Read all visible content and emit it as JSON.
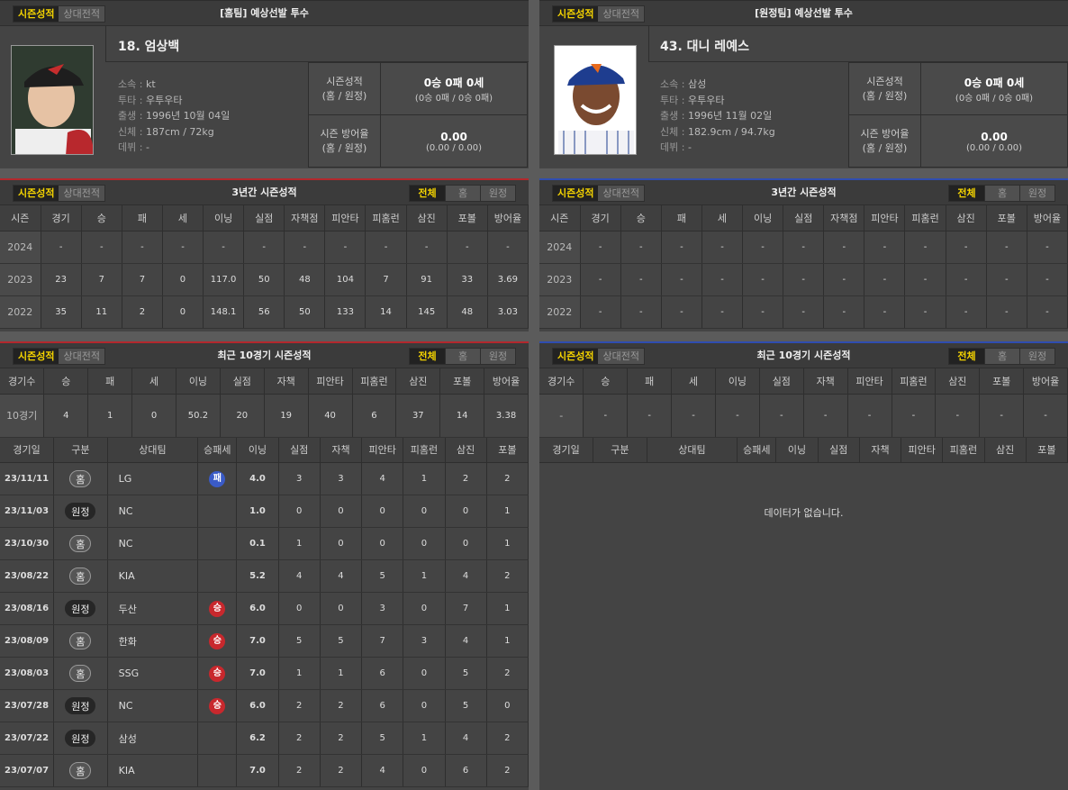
{
  "tabs": {
    "season": "시즌성적",
    "vs": "상대전적"
  },
  "seg": {
    "all": "전체",
    "home": "홈",
    "away": "원정"
  },
  "home": {
    "title": "[홈팀] 예상선발 투수",
    "name": "18. 엄상백",
    "info": [
      {
        "k": "소속",
        "v": "kt"
      },
      {
        "k": "투타",
        "v": "우투우타"
      },
      {
        "k": "출생",
        "v": "1996년 10월 04일"
      },
      {
        "k": "신체",
        "v": "187cm / 72kg"
      },
      {
        "k": "데뷔",
        "v": "-"
      }
    ],
    "record_label": "시즌성적\n(홈 / 원정)",
    "record_big": "0승 0패 0세",
    "record_small": "(0승 0패 / 0승 0패)",
    "era_label": "시즌 방어율\n(홈 / 원정)",
    "era_big": "0.00",
    "era_small": "(0.00 / 0.00)"
  },
  "away": {
    "title": "[원정팀] 예상선발 투수",
    "name": "43. 대니 레예스",
    "info": [
      {
        "k": "소속",
        "v": "삼성"
      },
      {
        "k": "투타",
        "v": "우투우타"
      },
      {
        "k": "출생",
        "v": "1996년 11월 02일"
      },
      {
        "k": "신체",
        "v": "182.9cm / 94.7kg"
      },
      {
        "k": "데뷔",
        "v": "-"
      }
    ],
    "record_label": "시즌성적\n(홈 / 원정)",
    "record_big": "0승 0패 0세",
    "record_small": "(0승 0패 / 0승 0패)",
    "era_label": "시즌 방어율\n(홈 / 원정)",
    "era_big": "0.00",
    "era_small": "(0.00 / 0.00)"
  },
  "season3": {
    "title": "3년간 시즌성적",
    "headers": [
      "시즌",
      "경기",
      "승",
      "패",
      "세",
      "이닝",
      "실점",
      "자책점",
      "피안타",
      "피홈런",
      "삼진",
      "포볼",
      "방어율"
    ],
    "home_rows": [
      [
        "2024",
        "-",
        "-",
        "-",
        "-",
        "-",
        "-",
        "-",
        "-",
        "-",
        "-",
        "-",
        "-"
      ],
      [
        "2023",
        "23",
        "7",
        "7",
        "0",
        "117.0",
        "50",
        "48",
        "104",
        "7",
        "91",
        "33",
        "3.69"
      ],
      [
        "2022",
        "35",
        "11",
        "2",
        "0",
        "148.1",
        "56",
        "50",
        "133",
        "14",
        "145",
        "48",
        "3.03"
      ]
    ],
    "away_rows": [
      [
        "2024",
        "-",
        "-",
        "-",
        "-",
        "-",
        "-",
        "-",
        "-",
        "-",
        "-",
        "-",
        "-"
      ],
      [
        "2023",
        "-",
        "-",
        "-",
        "-",
        "-",
        "-",
        "-",
        "-",
        "-",
        "-",
        "-",
        "-"
      ],
      [
        "2022",
        "-",
        "-",
        "-",
        "-",
        "-",
        "-",
        "-",
        "-",
        "-",
        "-",
        "-",
        "-"
      ]
    ]
  },
  "recent10": {
    "title": "최근 10경기 시즌성적",
    "headers": [
      "경기수",
      "승",
      "패",
      "세",
      "이닝",
      "실점",
      "자책",
      "피안타",
      "피홈런",
      "삼진",
      "포볼",
      "방어율"
    ],
    "home_row": [
      "10경기",
      "4",
      "1",
      "0",
      "50.2",
      "20",
      "19",
      "40",
      "6",
      "37",
      "14",
      "3.38"
    ],
    "away_row": [
      "-",
      "-",
      "-",
      "-",
      "-",
      "-",
      "-",
      "-",
      "-",
      "-",
      "-",
      "-"
    ]
  },
  "games": {
    "headers": [
      "경기일",
      "구분",
      "상대팀",
      "승패세",
      "이닝",
      "실점",
      "자책",
      "피안타",
      "피홈런",
      "삼진",
      "포볼"
    ],
    "home_rows": [
      {
        "date": "23/11/11",
        "ha": "홈",
        "haType": "home",
        "opp": "LG",
        "wl": "패",
        "wlType": "l",
        "ip": "4.0",
        "r": "3",
        "er": "3",
        "h": "4",
        "hr": "1",
        "so": "2",
        "bb": "2"
      },
      {
        "date": "23/11/03",
        "ha": "원정",
        "haType": "away",
        "opp": "NC",
        "wl": "",
        "wlType": "",
        "ip": "1.0",
        "r": "0",
        "er": "0",
        "h": "0",
        "hr": "0",
        "so": "0",
        "bb": "1"
      },
      {
        "date": "23/10/30",
        "ha": "홈",
        "haType": "home",
        "opp": "NC",
        "wl": "",
        "wlType": "",
        "ip": "0.1",
        "r": "1",
        "er": "0",
        "h": "0",
        "hr": "0",
        "so": "0",
        "bb": "1"
      },
      {
        "date": "23/08/22",
        "ha": "홈",
        "haType": "home",
        "opp": "KIA",
        "wl": "",
        "wlType": "",
        "ip": "5.2",
        "r": "4",
        "er": "4",
        "h": "5",
        "hr": "1",
        "so": "4",
        "bb": "2"
      },
      {
        "date": "23/08/16",
        "ha": "원정",
        "haType": "away",
        "opp": "두산",
        "wl": "승",
        "wlType": "w",
        "ip": "6.0",
        "r": "0",
        "er": "0",
        "h": "3",
        "hr": "0",
        "so": "7",
        "bb": "1"
      },
      {
        "date": "23/08/09",
        "ha": "홈",
        "haType": "home",
        "opp": "한화",
        "wl": "승",
        "wlType": "w",
        "ip": "7.0",
        "r": "5",
        "er": "5",
        "h": "7",
        "hr": "3",
        "so": "4",
        "bb": "1"
      },
      {
        "date": "23/08/03",
        "ha": "홈",
        "haType": "home",
        "opp": "SSG",
        "wl": "승",
        "wlType": "w",
        "ip": "7.0",
        "r": "1",
        "er": "1",
        "h": "6",
        "hr": "0",
        "so": "5",
        "bb": "2"
      },
      {
        "date": "23/07/28",
        "ha": "원정",
        "haType": "away",
        "opp": "NC",
        "wl": "승",
        "wlType": "w",
        "ip": "6.0",
        "r": "2",
        "er": "2",
        "h": "6",
        "hr": "0",
        "so": "5",
        "bb": "0"
      },
      {
        "date": "23/07/22",
        "ha": "원정",
        "haType": "away",
        "opp": "삼성",
        "wl": "",
        "wlType": "",
        "ip": "6.2",
        "r": "2",
        "er": "2",
        "h": "5",
        "hr": "1",
        "so": "4",
        "bb": "2"
      },
      {
        "date": "23/07/07",
        "ha": "홈",
        "haType": "home",
        "opp": "KIA",
        "wl": "",
        "wlType": "",
        "ip": "7.0",
        "r": "2",
        "er": "2",
        "h": "4",
        "hr": "0",
        "so": "6",
        "bb": "2"
      }
    ],
    "no_data": "데이터가 없습니다."
  },
  "colors": {
    "accent": "#f5d400",
    "home_line": "#b3282d",
    "away_line": "#2f4db0",
    "win": "#c8282d",
    "loss": "#3a5bc7"
  }
}
